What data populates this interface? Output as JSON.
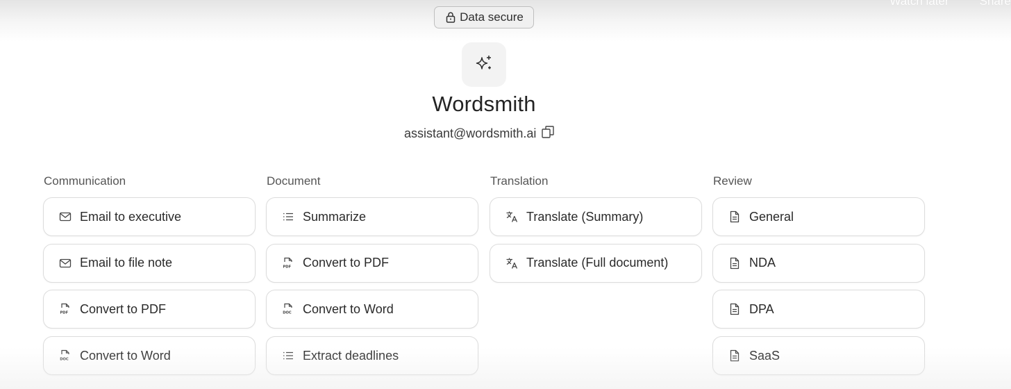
{
  "top_links": [
    "Watch later",
    "Share"
  ],
  "badge": {
    "label": "Data secure",
    "icon": "lock-icon"
  },
  "assistant": {
    "name": "Wordsmith",
    "email": "assistant@wordsmith.ai",
    "logo_icon": "sparkle-icon",
    "copy_icon": "copy-icon"
  },
  "columns": [
    {
      "title": "Communication",
      "items": [
        {
          "label": "Email to executive",
          "icon": "mail-icon"
        },
        {
          "label": "Email to file note",
          "icon": "mail-icon"
        },
        {
          "label": "Convert to PDF",
          "icon": "pdf-file-icon"
        },
        {
          "label": "Convert to Word",
          "icon": "doc-file-icon"
        }
      ]
    },
    {
      "title": "Document",
      "items": [
        {
          "label": "Summarize",
          "icon": "list-icon"
        },
        {
          "label": "Convert to PDF",
          "icon": "pdf-file-icon"
        },
        {
          "label": "Convert to Word",
          "icon": "doc-file-icon"
        },
        {
          "label": "Extract deadlines",
          "icon": "list-icon"
        }
      ]
    },
    {
      "title": "Translation",
      "items": [
        {
          "label": "Translate (Summary)",
          "icon": "translate-icon"
        },
        {
          "label": "Translate (Full document)",
          "icon": "translate-icon"
        }
      ]
    },
    {
      "title": "Review",
      "items": [
        {
          "label": "General",
          "icon": "document-icon"
        },
        {
          "label": "NDA",
          "icon": "document-icon"
        },
        {
          "label": "DPA",
          "icon": "document-icon"
        },
        {
          "label": "SaaS",
          "icon": "document-icon"
        }
      ]
    }
  ]
}
